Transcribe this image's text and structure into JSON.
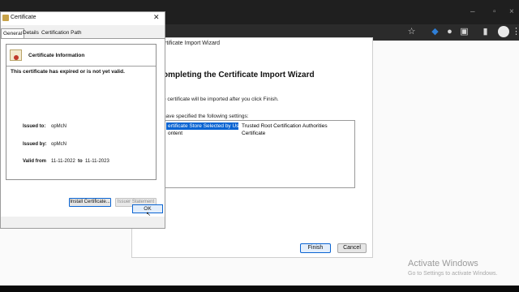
{
  "browser": {
    "url_fragment": "ml",
    "icons": [
      "minimize-icon",
      "maximize-icon",
      "close-icon",
      "star-icon",
      "shield-icon",
      "extensions-icon",
      "sidebar-icon",
      "profile-icon",
      "menu-icon"
    ]
  },
  "wizard": {
    "breadcrumb": "rtificate Import Wizard",
    "title": "ompleting the Certificate Import Wizard",
    "description": "e certificate will be imported after you click Finish.",
    "specified": "have specified the following settings:",
    "settings": [
      {
        "key": "ertificate Store Selected by User",
        "value": "Trusted Root Certification Authorities",
        "selected": true
      },
      {
        "key": "ontent",
        "value": "Certificate",
        "selected": false
      }
    ],
    "finish_label": "Finish",
    "cancel_label": "Cancel"
  },
  "certificate": {
    "title": "Certificate",
    "tabs": [
      "General",
      "Details",
      "Certification Path"
    ],
    "active_tab": "General",
    "info_heading": "Certificate Information",
    "status_text": "This certificate has expired or is not yet valid.",
    "issued_to_label": "Issued to:",
    "issued_to": "opMcN",
    "issued_by_label": "Issued by:",
    "issued_by": "opMcN",
    "valid_from_label": "Valid from",
    "valid_from": "11-11-2022",
    "to_label": "to",
    "valid_to": "11-11-2023",
    "install_label": "Install Certificate...",
    "issuer_statement_label": "Issuer Statement",
    "ok_label": "OK"
  },
  "watermark": {
    "line1": "Activate Windows",
    "line2": "Go to Settings to activate Windows."
  },
  "colors": {
    "selection": "#0a64d2",
    "chrome_dark": "#2b2b2b"
  }
}
